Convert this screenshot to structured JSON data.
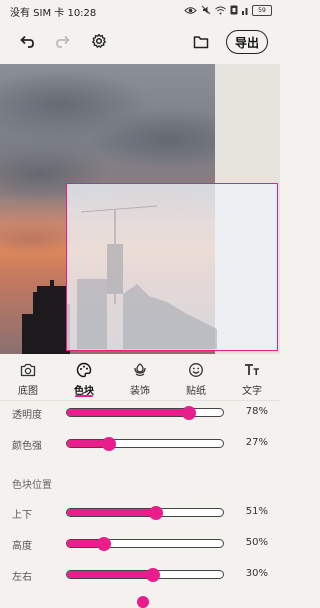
{
  "status_bar": {
    "carrier_time": "没有 SIM 卡 10:28",
    "battery": "59"
  },
  "toolbar": {
    "export_label": "导出"
  },
  "tabs": [
    {
      "label": "底图",
      "icon": "camera-icon",
      "active": false
    },
    {
      "label": "色块",
      "icon": "palette-icon",
      "active": true
    },
    {
      "label": "装饰",
      "icon": "flower-icon",
      "active": false
    },
    {
      "label": "贴纸",
      "icon": "smiley-icon",
      "active": false
    },
    {
      "label": "文字",
      "icon": "text-icon",
      "active": false
    }
  ],
  "sliders": {
    "opacity": {
      "label": "透明度",
      "value": 78,
      "display": "78%"
    },
    "saturation": {
      "label": "颜色强",
      "value": 27,
      "display": "27%"
    }
  },
  "position_section": {
    "title": "色块位置",
    "sliders": {
      "vertical": {
        "label": "上下",
        "value": 57,
        "display": "51%"
      },
      "height": {
        "label": "高度",
        "value": 24,
        "display": "50%"
      },
      "horizontal": {
        "label": "左右",
        "value": 55,
        "display": "30%"
      }
    }
  },
  "colors": {
    "accent": "#e91e8c",
    "background": "#f4f2ee"
  }
}
